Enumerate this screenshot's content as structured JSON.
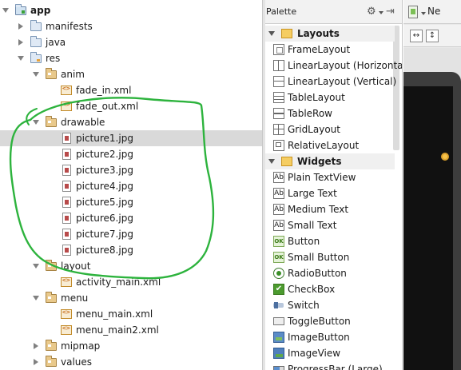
{
  "project_tree": {
    "nodes": [
      {
        "label": "app",
        "depth": 0,
        "expanded": true,
        "icon": "app-module-icon",
        "bold": true
      },
      {
        "label": "manifests",
        "depth": 1,
        "expanded": false,
        "icon": "folder-icon"
      },
      {
        "label": "java",
        "depth": 1,
        "expanded": false,
        "icon": "folder-icon"
      },
      {
        "label": "res",
        "depth": 1,
        "expanded": true,
        "icon": "res-folder-icon"
      },
      {
        "label": "anim",
        "depth": 2,
        "expanded": true,
        "icon": "package-folder-icon"
      },
      {
        "label": "fade_in.xml",
        "depth": 3,
        "icon": "xml-file-icon"
      },
      {
        "label": "fade_out.xml",
        "depth": 3,
        "icon": "xml-file-icon"
      },
      {
        "label": "drawable",
        "depth": 2,
        "expanded": true,
        "icon": "package-folder-icon"
      },
      {
        "label": "picture1.jpg",
        "depth": 3,
        "icon": "image-file-icon",
        "selected": true
      },
      {
        "label": "picture2.jpg",
        "depth": 3,
        "icon": "image-file-icon"
      },
      {
        "label": "picture3.jpg",
        "depth": 3,
        "icon": "image-file-icon"
      },
      {
        "label": "picture4.jpg",
        "depth": 3,
        "icon": "image-file-icon"
      },
      {
        "label": "picture5.jpg",
        "depth": 3,
        "icon": "image-file-icon"
      },
      {
        "label": "picture6.jpg",
        "depth": 3,
        "icon": "image-file-icon"
      },
      {
        "label": "picture7.jpg",
        "depth": 3,
        "icon": "image-file-icon"
      },
      {
        "label": "picture8.jpg",
        "depth": 3,
        "icon": "image-file-icon"
      },
      {
        "label": "layout",
        "depth": 2,
        "expanded": true,
        "icon": "package-folder-icon"
      },
      {
        "label": "activity_main.xml",
        "depth": 3,
        "icon": "xml-file-icon"
      },
      {
        "label": "menu",
        "depth": 2,
        "expanded": true,
        "icon": "package-folder-icon"
      },
      {
        "label": "menu_main.xml",
        "depth": 3,
        "icon": "xml-file-icon"
      },
      {
        "label": "menu_main2.xml",
        "depth": 3,
        "icon": "xml-file-icon"
      },
      {
        "label": "mipmap",
        "depth": 2,
        "expanded": false,
        "icon": "package-folder-icon"
      },
      {
        "label": "values",
        "depth": 2,
        "expanded": false,
        "icon": "package-folder-icon"
      }
    ],
    "annotation_color": "#2db33d"
  },
  "palette": {
    "title": "Palette",
    "gear_icon": "gear-icon",
    "pin_icon": "pin-icon",
    "categories": [
      {
        "label": "Layouts",
        "items": [
          {
            "label": "FrameLayout",
            "icon": "frame"
          },
          {
            "label": "LinearLayout (Horizontal)",
            "icon": "linh"
          },
          {
            "label": "LinearLayout (Vertical)",
            "icon": "linv"
          },
          {
            "label": "TableLayout",
            "icon": "table"
          },
          {
            "label": "TableRow",
            "icon": "tablerow"
          },
          {
            "label": "GridLayout",
            "icon": "grid"
          },
          {
            "label": "RelativeLayout",
            "icon": "rel"
          }
        ]
      },
      {
        "label": "Widgets",
        "items": [
          {
            "label": "Plain TextView",
            "icon": "ab"
          },
          {
            "label": "Large Text",
            "icon": "ab"
          },
          {
            "label": "Medium Text",
            "icon": "ab"
          },
          {
            "label": "Small Text",
            "icon": "ab"
          },
          {
            "label": "Button",
            "icon": "ok"
          },
          {
            "label": "Small Button",
            "icon": "ok"
          },
          {
            "label": "RadioButton",
            "icon": "radio"
          },
          {
            "label": "CheckBox",
            "icon": "check"
          },
          {
            "label": "Switch",
            "icon": "switch"
          },
          {
            "label": "ToggleButton",
            "icon": "toggle"
          },
          {
            "label": "ImageButton",
            "icon": "imgbtn"
          },
          {
            "label": "ImageView",
            "icon": "imgview"
          },
          {
            "label": "ProgressBar (Large)",
            "icon": "progress"
          }
        ]
      }
    ],
    "icon_glyphs": {
      "ab": "Ab",
      "ok": "OK",
      "check": "✔"
    }
  },
  "designer": {
    "device_label": "Ne",
    "tool_icons": [
      "fit-width-icon",
      "fit-height-icon"
    ]
  }
}
